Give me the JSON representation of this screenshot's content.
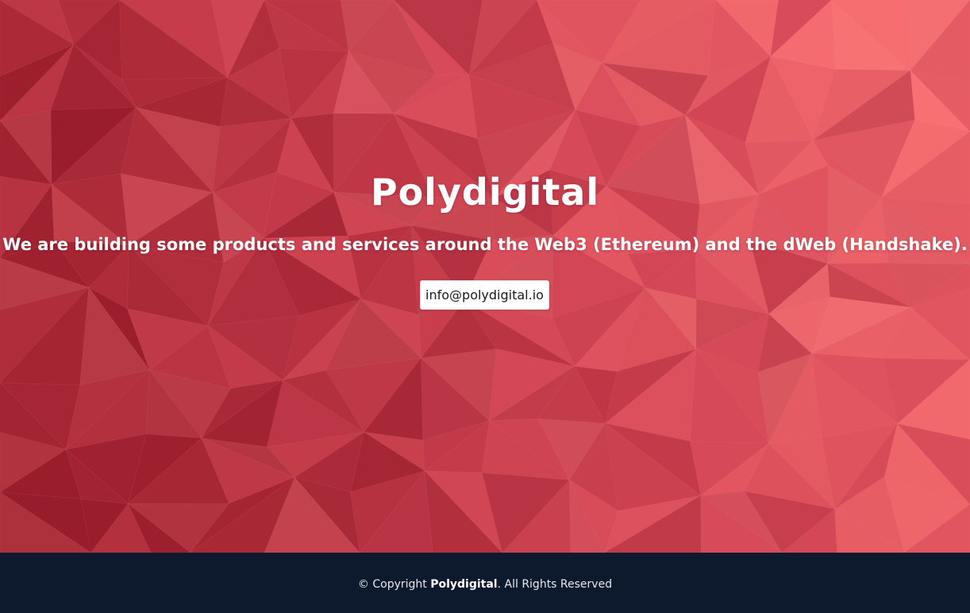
{
  "hero": {
    "title": "Polydigital",
    "tagline": "We are building some products and services around the Web3 (Ethereum) and the dWeb (Handshake).",
    "email_button_label": "info@polydigital.io"
  },
  "footer": {
    "copyright_prefix": "© Copyright",
    "brand": "Polydigital",
    "rights": ". All Rights Reserved"
  },
  "colors": {
    "hero_base": "#d84a59",
    "hero_dark": "#9d1f2d",
    "hero_light": "#ff7676",
    "footer_background": "#0d1a2d",
    "text_light": "#ffffff"
  }
}
